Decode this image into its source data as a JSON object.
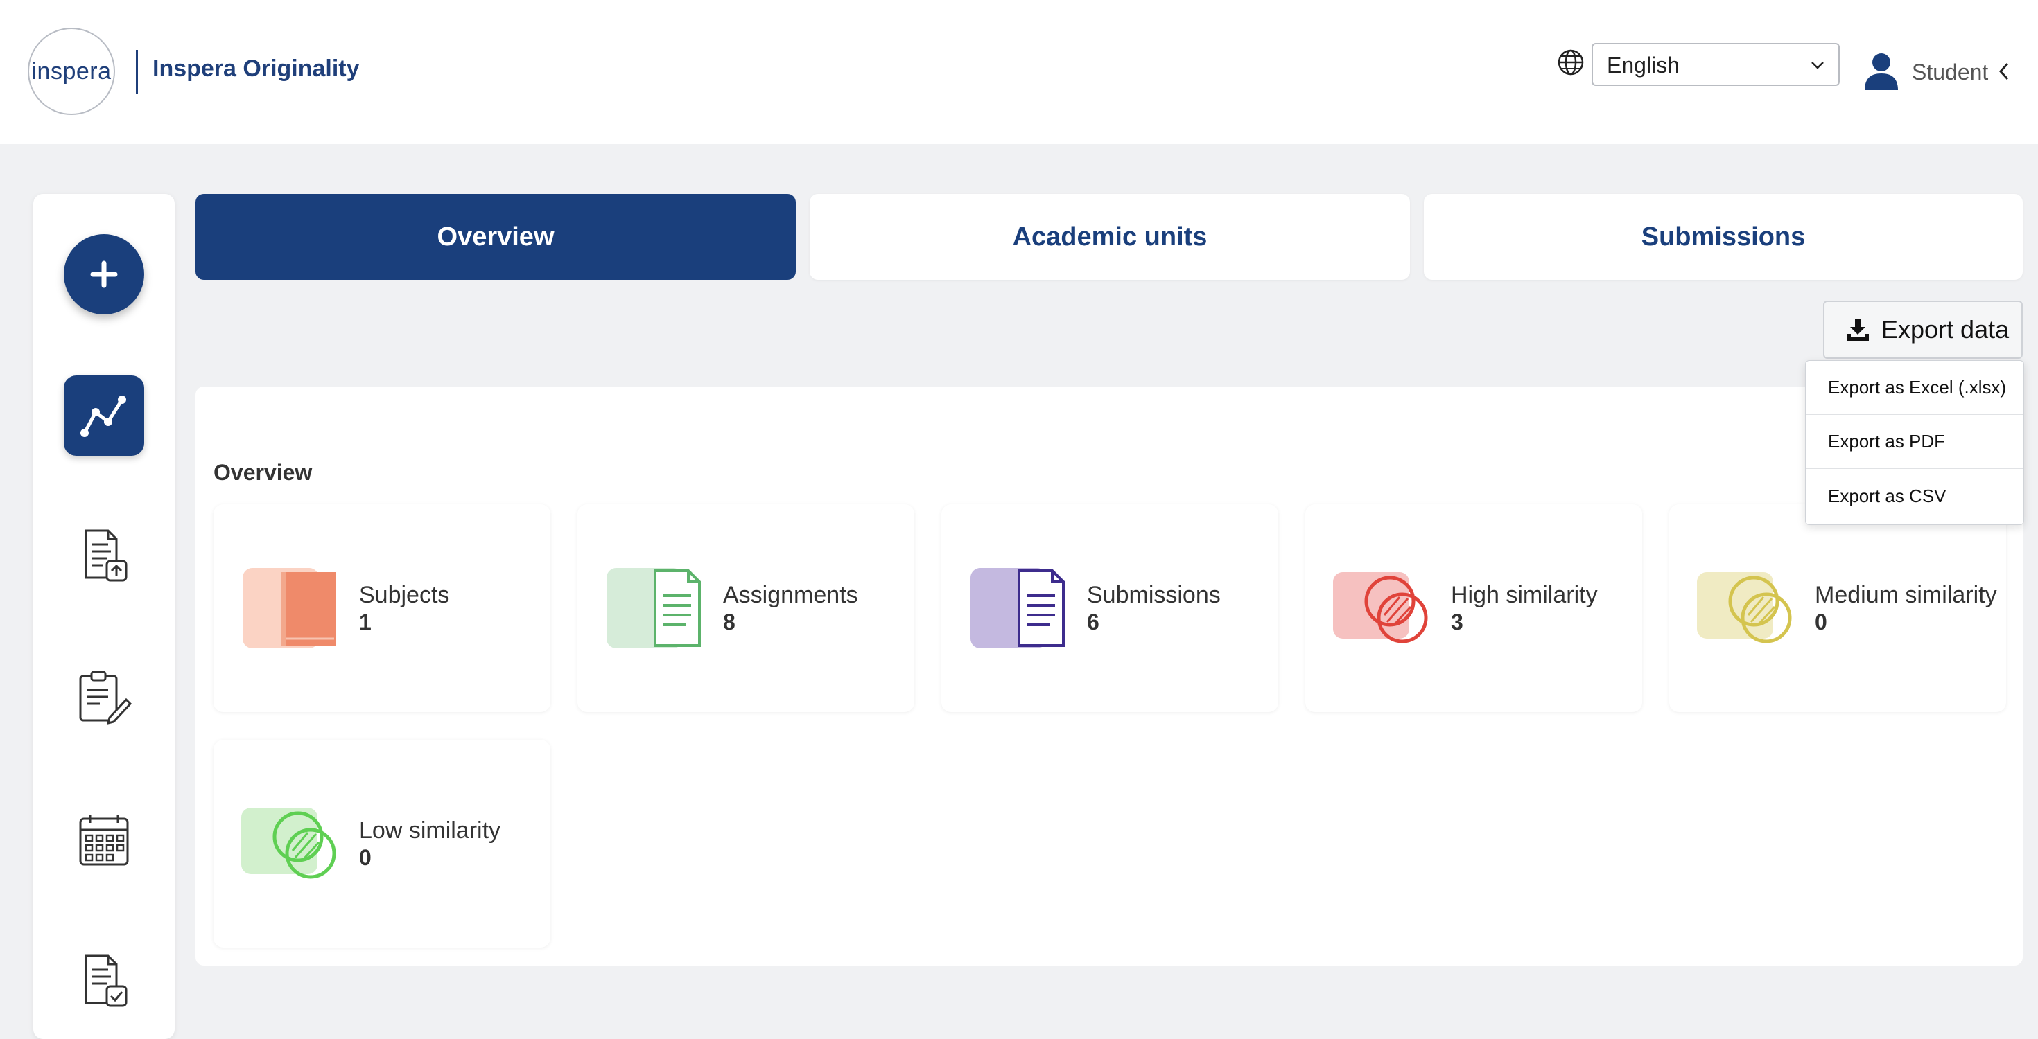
{
  "header": {
    "logo_text": "inspera",
    "brand": "Inspera Originality",
    "language": "English",
    "user_role": "Student"
  },
  "tabs": [
    {
      "label": "Overview",
      "active": true
    },
    {
      "label": "Academic units",
      "active": false
    },
    {
      "label": "Submissions",
      "active": false
    }
  ],
  "export": {
    "button_label": "Export data",
    "options": [
      "Export as Excel (.xlsx)",
      "Export as PDF",
      "Export as CSV"
    ]
  },
  "overview": {
    "title": "Overview",
    "cards": [
      {
        "label": "Subjects",
        "value": "1",
        "icon": "book-icon",
        "color": "#ef8a6a"
      },
      {
        "label": "Assignments",
        "value": "8",
        "icon": "document-icon",
        "color": "#5cb36b"
      },
      {
        "label": "Submissions",
        "value": "6",
        "icon": "document-icon",
        "color": "#3d2c8d"
      },
      {
        "label": "High similarity",
        "value": "3",
        "icon": "similarity-icon",
        "color": "#e0433a"
      },
      {
        "label": "Medium similarity",
        "value": "0",
        "icon": "similarity-icon",
        "color": "#d4c44f"
      },
      {
        "label": "Low similarity",
        "value": "0",
        "icon": "similarity-icon",
        "color": "#5fcf53"
      }
    ]
  },
  "colors": {
    "primary": "#1a3f7c",
    "background": "#f0f1f3"
  }
}
